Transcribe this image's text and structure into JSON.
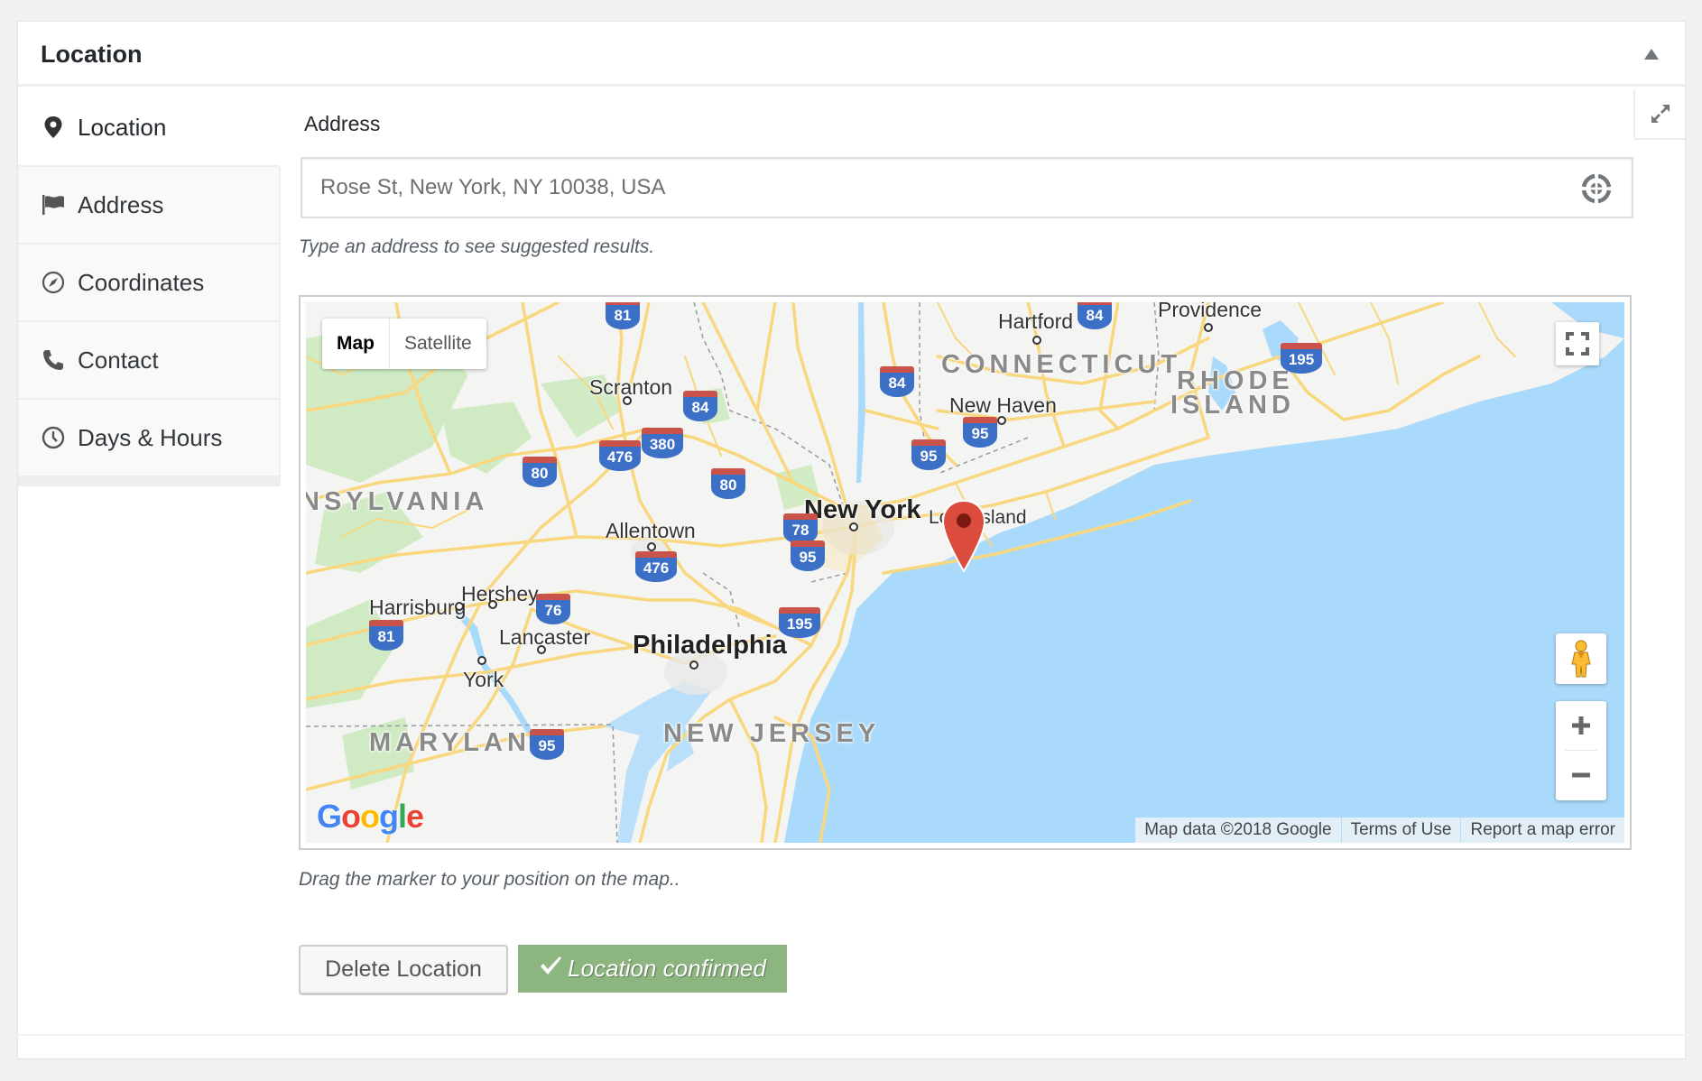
{
  "panel": {
    "title": "Location",
    "collapse_icon": "triangle-up-icon",
    "expand_icon": "expand-arrows-icon"
  },
  "sidebar": {
    "items": [
      {
        "label": "Location",
        "icon": "map-pin-icon",
        "active": true
      },
      {
        "label": "Address",
        "icon": "flag-icon",
        "active": false
      },
      {
        "label": "Coordinates",
        "icon": "compass-icon",
        "active": false
      },
      {
        "label": "Contact",
        "icon": "phone-icon",
        "active": false
      },
      {
        "label": "Days & Hours",
        "icon": "clock-icon",
        "active": false
      }
    ]
  },
  "address": {
    "label": "Address",
    "value": "Rose St, New York, NY 10038, USA",
    "help": "Type an address to see suggested results.",
    "locate_icon": "crosshair-icon"
  },
  "map": {
    "type_options": [
      "Map",
      "Satellite"
    ],
    "selected_type": "Map",
    "fullscreen_icon": "fullscreen-icon",
    "pegman_icon": "street-view-pegman-icon",
    "zoom_in": "+",
    "zoom_out": "−",
    "attribution": {
      "data": "Map data ©2018 Google",
      "terms": "Terms of Use",
      "report": "Report a map error"
    },
    "logo": "Google",
    "cities": {
      "new_york": "New York",
      "philadelphia": "Philadelphia",
      "allentown": "Allentown",
      "scranton": "Scranton",
      "harrisburg": "Harrisburg",
      "hershey": "Hershey",
      "lancaster": "Lancaster",
      "york": "York",
      "hartford": "Hartford",
      "new_haven": "New Haven",
      "providence": "Providence"
    },
    "regions": {
      "long_island": "Long Island"
    },
    "states": {
      "pennsylvania": "NSYLVANIA",
      "connecticut": "CONNECTICUT",
      "rhode": "RHODE",
      "island": "ISLAND",
      "new_jersey": "NEW JERSEY",
      "maryland": "MARYLAND"
    },
    "shields": {
      "i81_top": "81",
      "i84_top": "84",
      "i84_mid": "84",
      "i84_scr": "84",
      "i476_a": "476",
      "i380": "380",
      "i80_a": "80",
      "i80_b": "80",
      "i95_ct": "95",
      "i95_ny": "95",
      "i95_nj": "95",
      "i78": "78",
      "i476_b": "476",
      "i76": "76",
      "i81_b": "81",
      "i195_nj": "195",
      "i195_ri": "195",
      "i95_md": "95"
    },
    "colors": {
      "water": "#AADAFB",
      "land": "#F4F4F2",
      "road": "#F9D77E",
      "park": "#CDEBC0",
      "marker": "#DB4C3F"
    }
  },
  "instructions": "Drag the marker to your position on the map..",
  "buttons": {
    "delete": "Delete Location",
    "confirmed": "Location confirmed",
    "confirmed_icon": "checkmark-icon"
  }
}
